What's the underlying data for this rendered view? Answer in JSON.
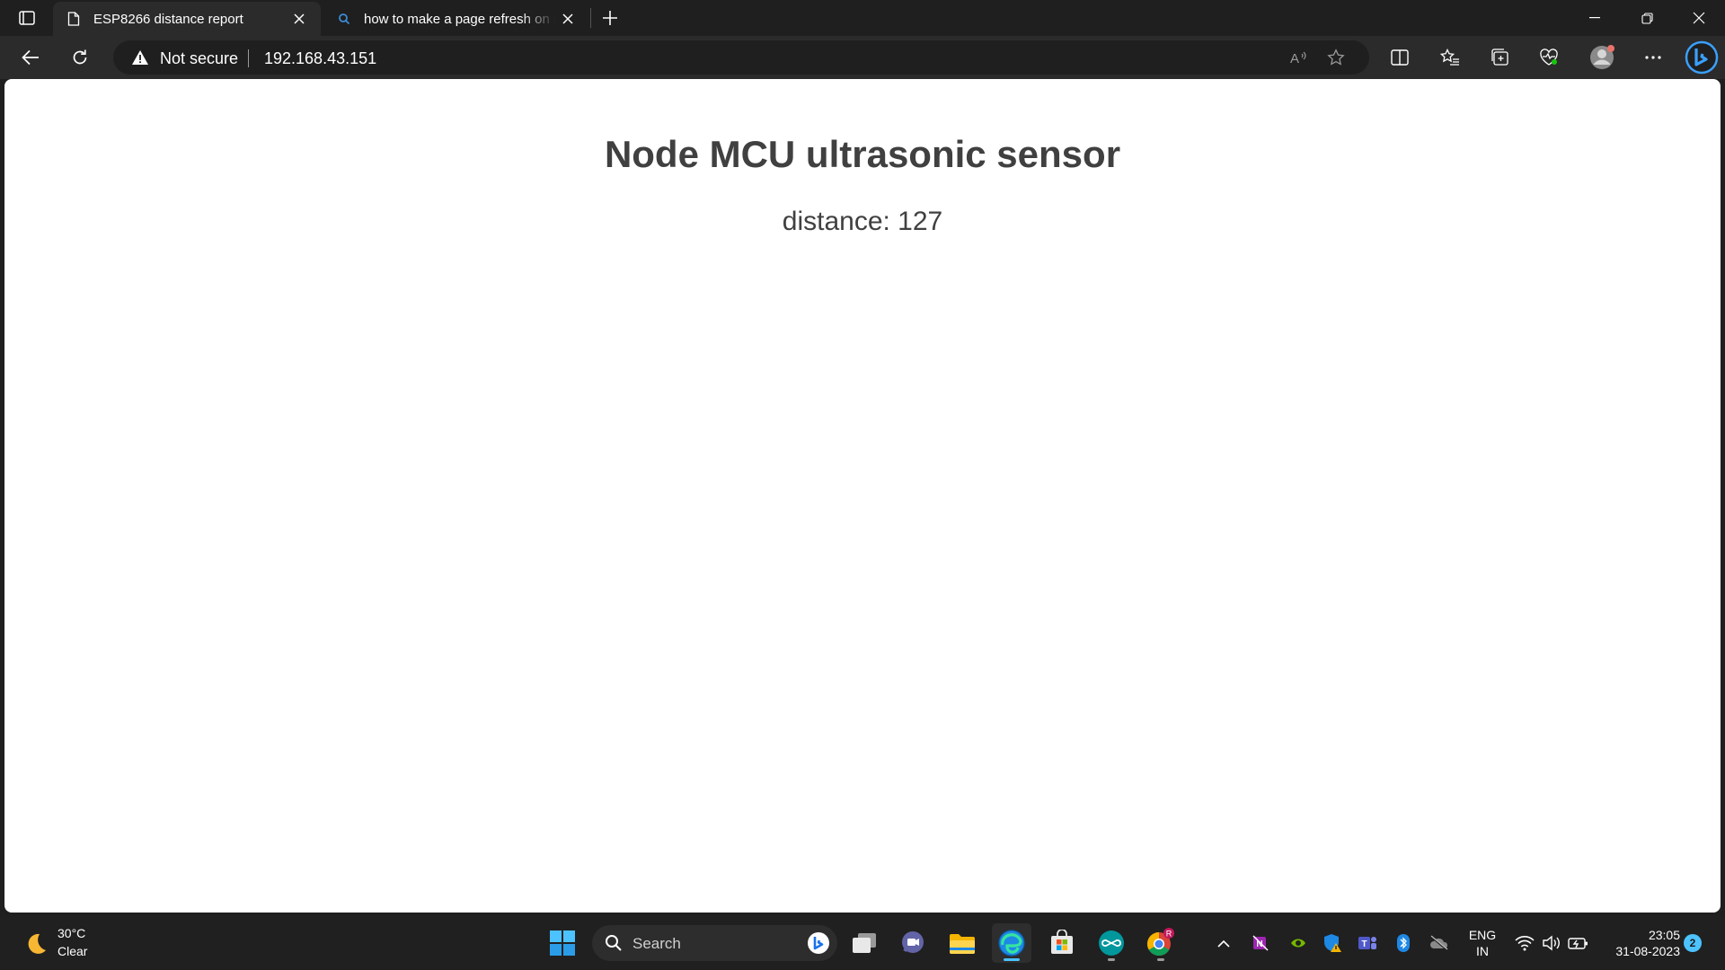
{
  "browser": {
    "tabs": [
      {
        "title": "ESP8266 distance report",
        "active": true,
        "favicon": "page-icon"
      },
      {
        "title": "how to make a page refresh on it",
        "active": false,
        "favicon": "search-icon"
      }
    ],
    "address": {
      "security_label": "Not secure",
      "url": "192.168.43.151"
    }
  },
  "page": {
    "heading": "Node MCU ultrasonic sensor",
    "distance_text": "distance: 127"
  },
  "taskbar": {
    "weather": {
      "temp": "30°C",
      "condition": "Clear"
    },
    "search_label": "Search",
    "language": {
      "line1": "ENG",
      "line2": "IN"
    },
    "clock": {
      "time": "23:05",
      "date": "31-08-2023"
    },
    "notification_count": "2",
    "chrome_badge": "R"
  },
  "colors": {
    "accent": "#4cc2ff",
    "page_text": "#404040",
    "titlebar": "#1f1f1f",
    "toolbar": "#2b2b2b"
  }
}
